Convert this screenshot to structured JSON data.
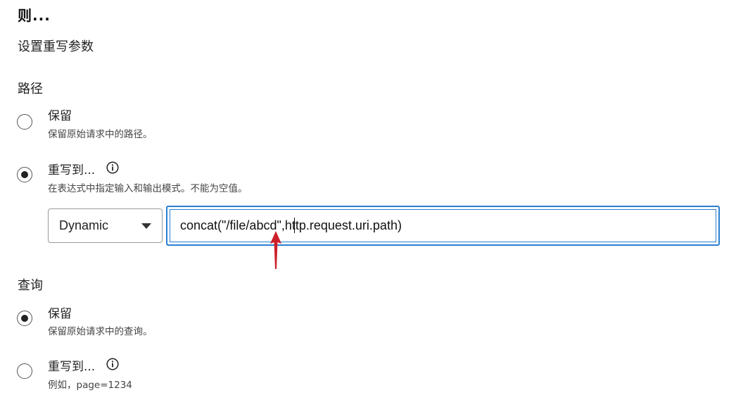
{
  "header": {
    "title": "则...",
    "subtitle": "设置重写参数"
  },
  "path": {
    "title": "路径",
    "options": [
      {
        "label": "保留",
        "desc": "保留原始请求中的路径。",
        "checked": false
      },
      {
        "label": "重写到...",
        "desc": "在表达式中指定输入和输出模式。不能为空值。",
        "checked": true,
        "has_info": true
      }
    ],
    "mode_select": {
      "value": "Dynamic"
    },
    "expression": {
      "value": "concat(\"/file/abcd\",http.request.uri.path)"
    }
  },
  "query": {
    "title": "查询",
    "options": [
      {
        "label": "保留",
        "desc": "保留原始请求中的查询。",
        "checked": true
      },
      {
        "label": "重写到...",
        "desc": "例如，page=1234",
        "checked": false,
        "has_info": true
      }
    ]
  },
  "colors": {
    "focus_border": "#2a7fd0",
    "annotation_arrow": "#cc1f2a"
  },
  "icons": [
    "info-icon",
    "chevron-down-icon",
    "red-arrow-annotation"
  ]
}
